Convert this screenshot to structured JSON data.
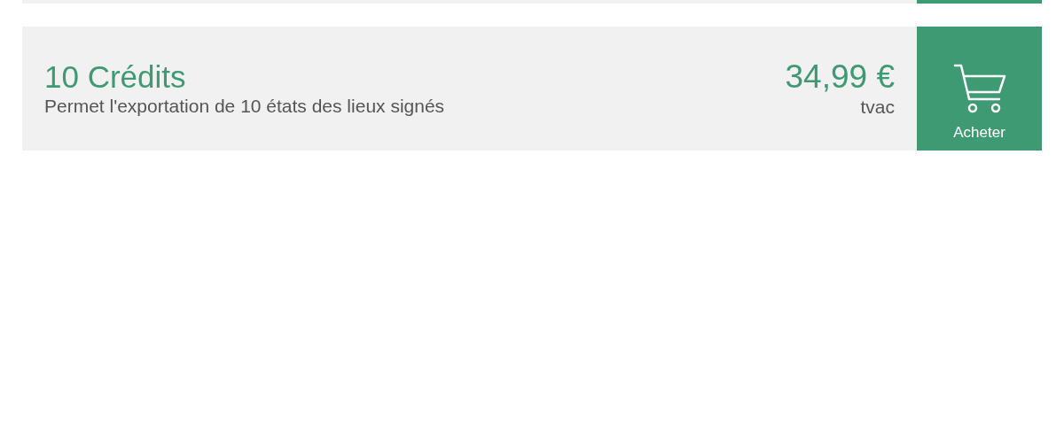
{
  "products": [
    {
      "title": "10 Crédits",
      "description": "Permet l'exportation de 10 états des lieux signés",
      "price": "34,99 €",
      "tax_note": "tvac",
      "button": "Acheter"
    }
  ]
}
